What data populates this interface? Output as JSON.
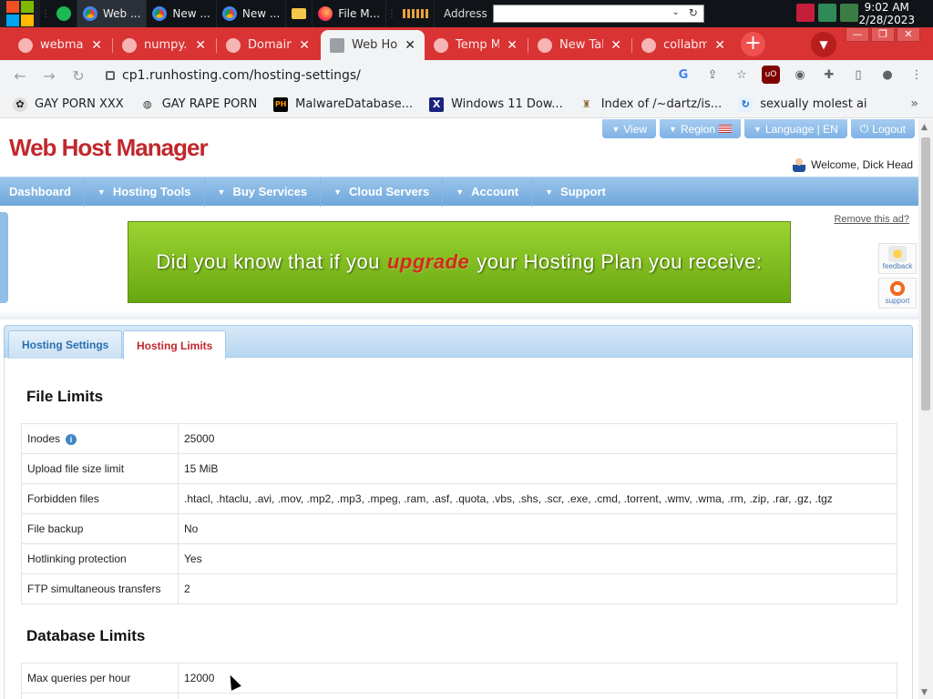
{
  "taskbar": {
    "apps": [
      {
        "label": "Web ..."
      },
      {
        "label": "New ..."
      },
      {
        "label": "New ..."
      },
      {
        "label": "File M..."
      }
    ],
    "address_label": "Address",
    "time": "9:02 AM",
    "date": "2/28/2023"
  },
  "tabs": [
    {
      "label": "webmail"
    },
    {
      "label": "numpy.c"
    },
    {
      "label": "Domain I"
    },
    {
      "label": "Web Ho"
    },
    {
      "label": "Temp M"
    },
    {
      "label": "New Tab"
    },
    {
      "label": "collabm"
    }
  ],
  "url": "cp1.runhosting.com/hosting-settings/",
  "bookmarks": [
    {
      "label": "GAY PORN XXX"
    },
    {
      "label": "GAY RAPE PORN"
    },
    {
      "label": "MalwareDatabase..."
    },
    {
      "label": "Windows 11 Dow..."
    },
    {
      "label": "Index of /~dartz/is..."
    },
    {
      "label": "sexually molest ai"
    }
  ],
  "site": {
    "logo": "Web Host Manager",
    "top_buttons": [
      "View",
      "Region",
      "Language | EN",
      "Logout"
    ],
    "welcome": "Welcome, Dick Head",
    "nav": [
      "Dashboard",
      "Hosting Tools",
      "Buy Services",
      "Cloud Servers",
      "Account",
      "Support"
    ],
    "remove_ad": "Remove this ad?",
    "banner": {
      "pre": "Did you know that if you",
      "highlight": "upgrade",
      "post": "your Hosting Plan you receive:"
    },
    "feedback": "feedback",
    "support": "support",
    "subtabs": [
      "Hosting Settings",
      "Hosting Limits"
    ]
  },
  "file_limits": {
    "title": "File Limits",
    "rows": [
      {
        "label": "Inodes",
        "value": "25000"
      },
      {
        "label": "Upload file size limit",
        "value": "15 MiB"
      },
      {
        "label": "Forbidden files",
        "value": ".htacl, .htaclu, .avi, .mov, .mp2, .mp3, .mpeg, .ram, .asf, .quota, .vbs, .shs, .scr, .exe, .cmd, .torrent, .wmv, .wma, .rm, .zip, .rar, .gz, .tgz"
      },
      {
        "label": "File backup",
        "value": "No"
      },
      {
        "label": "Hotlinking protection",
        "value": "Yes"
      },
      {
        "label": "FTP simultaneous transfers",
        "value": "2"
      }
    ]
  },
  "database_limits": {
    "title": "Database Limits",
    "rows": [
      {
        "label": "Max queries per hour",
        "value": "12000"
      }
    ]
  }
}
